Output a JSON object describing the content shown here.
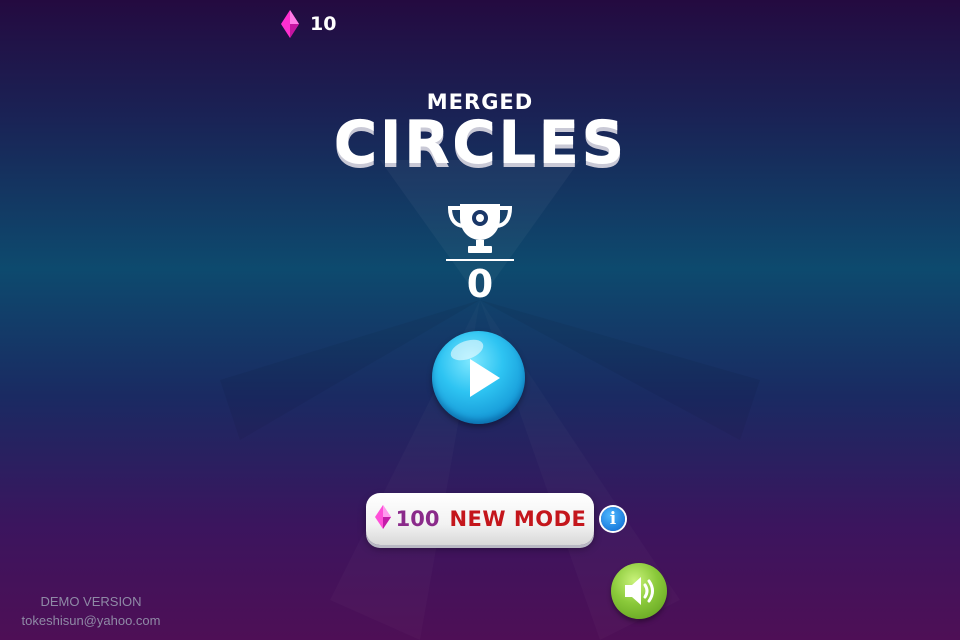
{
  "hud": {
    "gem_icon": "pink-diamond-icon",
    "gem_count": "10"
  },
  "title": {
    "small": "MERGED",
    "big": "CIRCLES"
  },
  "best_score": {
    "icon": "trophy-icon",
    "value": "0"
  },
  "play": {
    "icon": "play-triangle-icon"
  },
  "new_mode": {
    "cost": "100",
    "label": "NEW MODE",
    "icon": "pink-diamond-icon"
  },
  "info": {
    "glyph": "i"
  },
  "sound": {
    "icon": "speaker-icon"
  },
  "footer": {
    "demo": "DEMO VERSION",
    "email": "tokeshisun@yahoo.com"
  },
  "colors": {
    "gem": "#ff2fd0",
    "mode_label": "#c4161c",
    "play": "#1fb0ea",
    "sound": "#8ac93a"
  }
}
